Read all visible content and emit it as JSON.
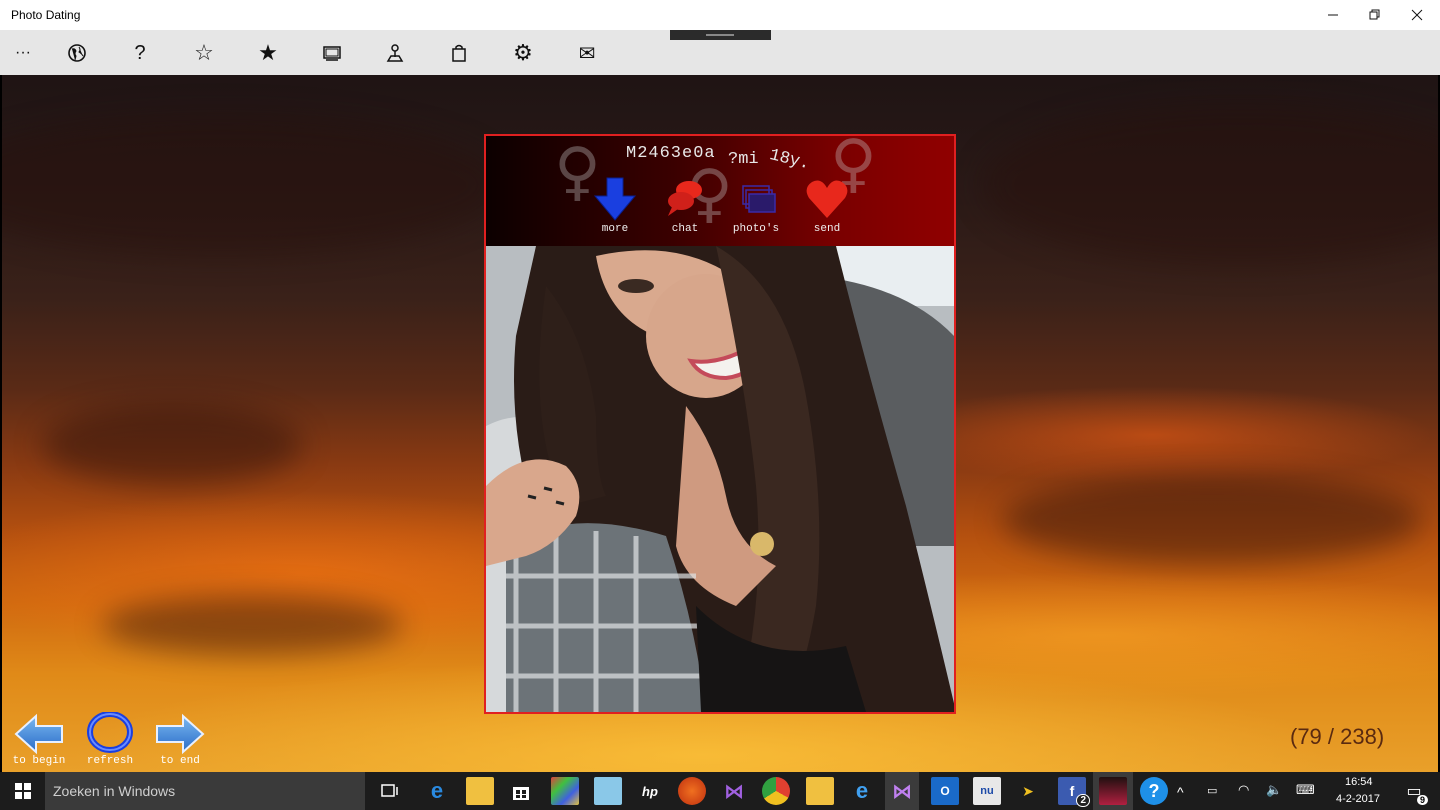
{
  "window": {
    "title": "Photo Dating"
  },
  "appbar": {
    "items": [
      {
        "icon": "more-icon",
        "glyph": "···"
      },
      {
        "icon": "globe-icon"
      },
      {
        "icon": "help-icon",
        "glyph": "?"
      },
      {
        "icon": "star-outline-icon",
        "glyph": "☆"
      },
      {
        "icon": "star-filled-icon",
        "glyph": "★"
      },
      {
        "icon": "slideshow-icon"
      },
      {
        "icon": "map-pin-icon"
      },
      {
        "icon": "shopping-bag-icon"
      },
      {
        "icon": "settings-icon",
        "glyph": "⚙"
      },
      {
        "icon": "mail-icon",
        "glyph": "✉"
      }
    ]
  },
  "profile": {
    "name": "M2463e0a",
    "distance": "?mi",
    "age": "18y.",
    "actions": {
      "more": "more",
      "chat": "chat",
      "photos": "photo's",
      "send": "send"
    }
  },
  "navigation": {
    "to_begin": "to begin",
    "refresh": "refresh",
    "to_end": "to end",
    "counter": "(79 / 238)"
  },
  "taskbar": {
    "search_placeholder": "Zoeken in Windows",
    "time": "16:54",
    "date": "4-2-2017",
    "notification_count": "9",
    "facebook_badge": "2"
  },
  "colors": {
    "accent_red": "#e02020",
    "more_blue": "#1a3fe0",
    "heart_red": "#e8281c",
    "chat_red": "#e8281c"
  }
}
